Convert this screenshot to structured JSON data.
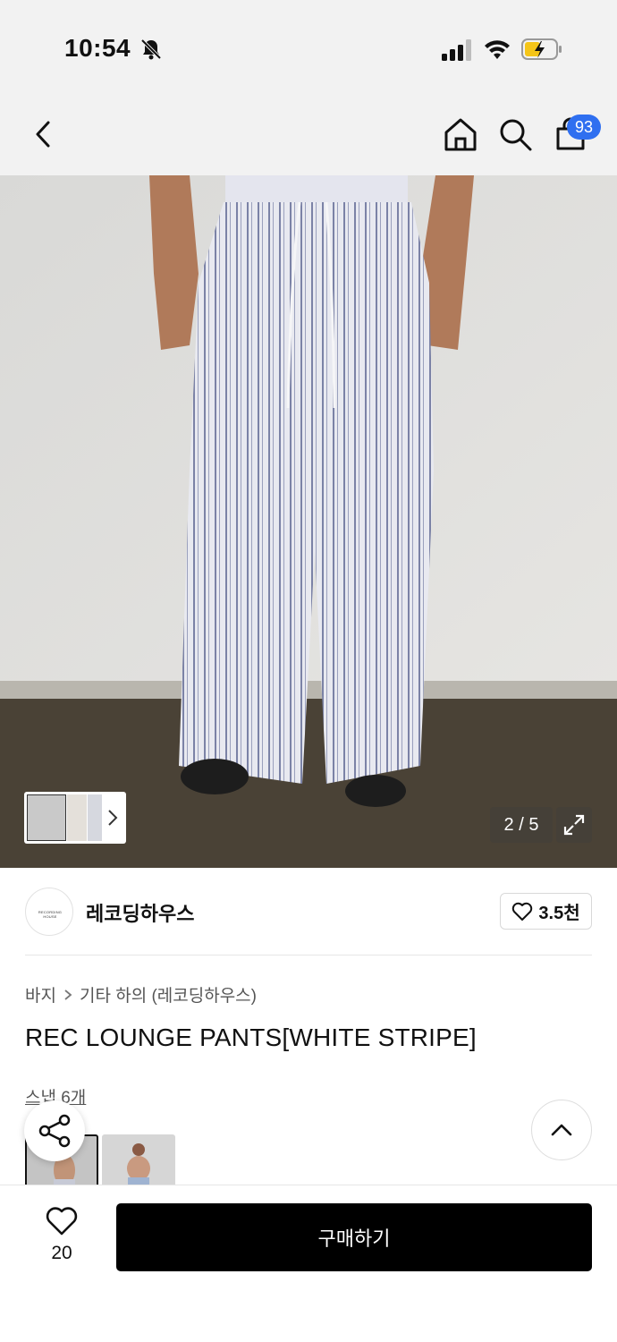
{
  "status_bar": {
    "time": "10:54",
    "icons": [
      "bell-slash-icon",
      "signal-icon",
      "wifi-icon",
      "battery-charging-icon"
    ]
  },
  "nav": {
    "icons": [
      "back-icon",
      "home-icon",
      "search-icon",
      "cart-icon"
    ],
    "cart_badge": "93"
  },
  "gallery": {
    "counter": "2 / 5",
    "icons": [
      "chevron-right-icon",
      "expand-icon"
    ]
  },
  "brand": {
    "logo_text": "RECORDING HOUSE",
    "name": "레코딩하우스",
    "like_count": "3.5천"
  },
  "breadcrumb": {
    "level1": "바지",
    "level2": "기타 하의 (레코딩하우스)"
  },
  "product": {
    "title": "REC LOUNGE PANTS[WHITE STRIPE]"
  },
  "snaps": {
    "label": "스냅 6개"
  },
  "bottom_bar": {
    "wish_count": "20",
    "buy_label": "구매하기"
  },
  "colors": {
    "accent_badge": "#2f6ff0",
    "buy_button": "#000000",
    "background_top": "#f2f2f2"
  }
}
